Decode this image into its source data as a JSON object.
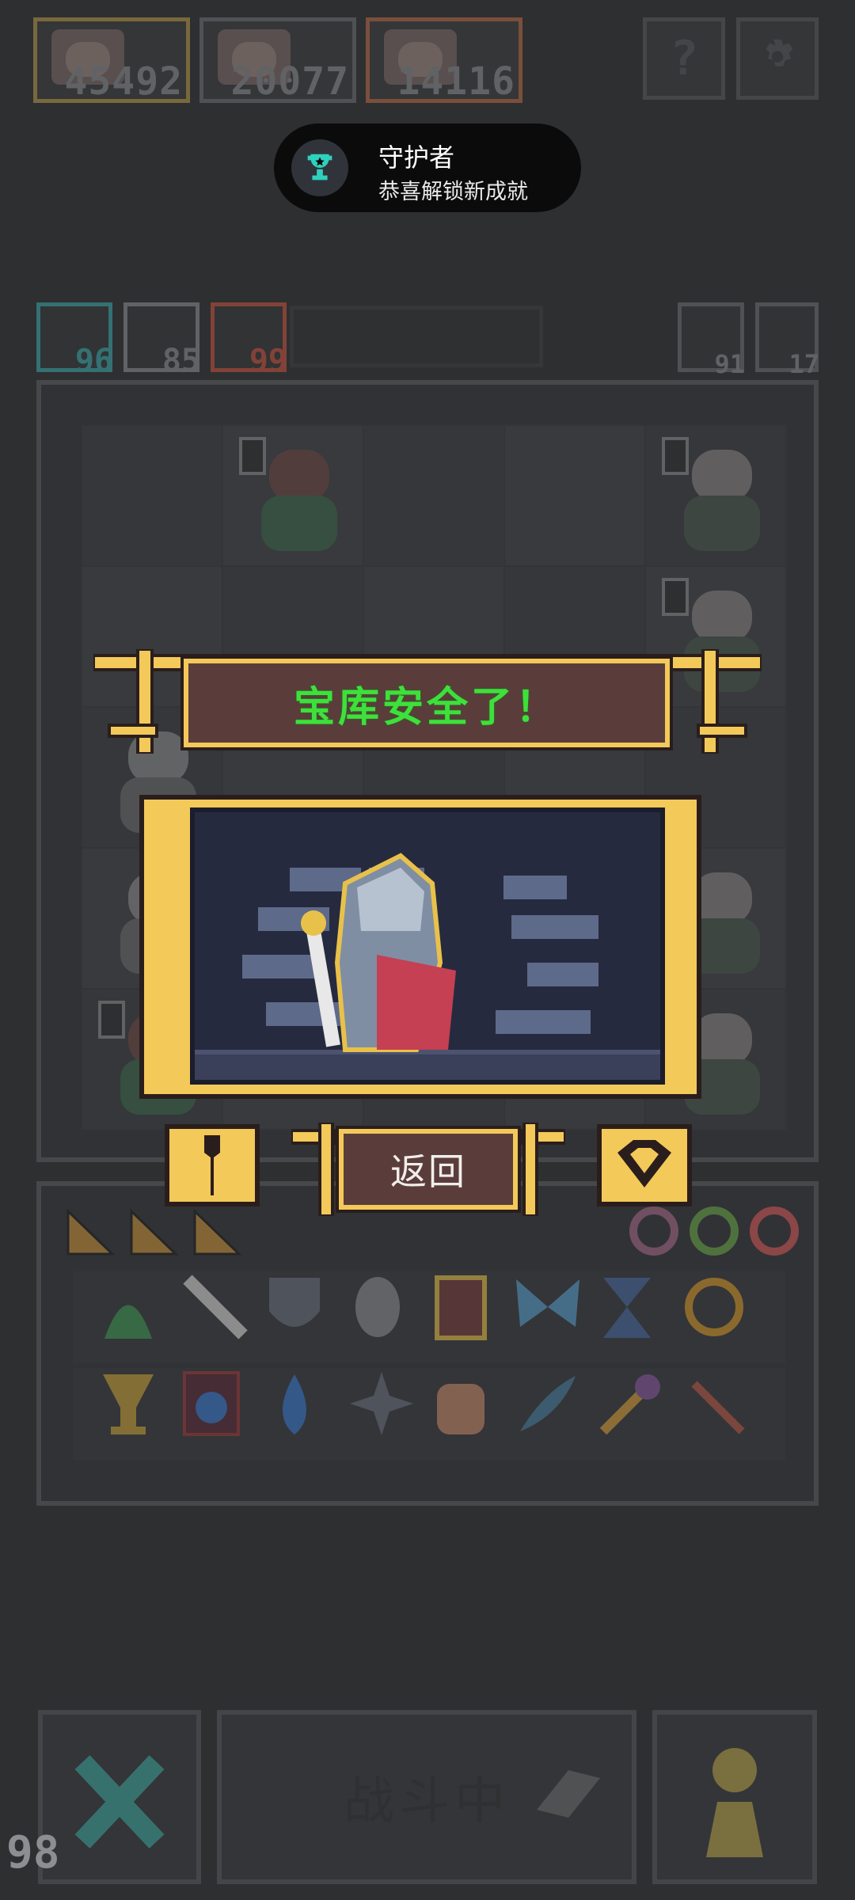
{
  "top_scores": [
    "45492",
    "20077",
    "14116"
  ],
  "top_buttons": {
    "help_icon": "?"
  },
  "achievement_toast": {
    "title": "守护者",
    "subtitle": "恭喜解锁新成就"
  },
  "resources_left": [
    {
      "name": "gem",
      "value": "96",
      "color": "#3aa7a9"
    },
    {
      "name": "wing",
      "value": "85",
      "color": "#8a8d90"
    },
    {
      "name": "fire",
      "value": "99",
      "color": "#c9523d"
    }
  ],
  "resources_right": [
    {
      "name": "move-up",
      "value": "91"
    },
    {
      "name": "pawn",
      "value": "17"
    }
  ],
  "popup": {
    "banner_text": "宝库安全了！",
    "back_button": "返回",
    "colors": {
      "gold": "#f3c95a",
      "panel": "#5a3d3b",
      "text_green": "#3ee03c"
    }
  },
  "bottom_bar": {
    "fight_label": "战斗中",
    "corner_count": "98"
  }
}
